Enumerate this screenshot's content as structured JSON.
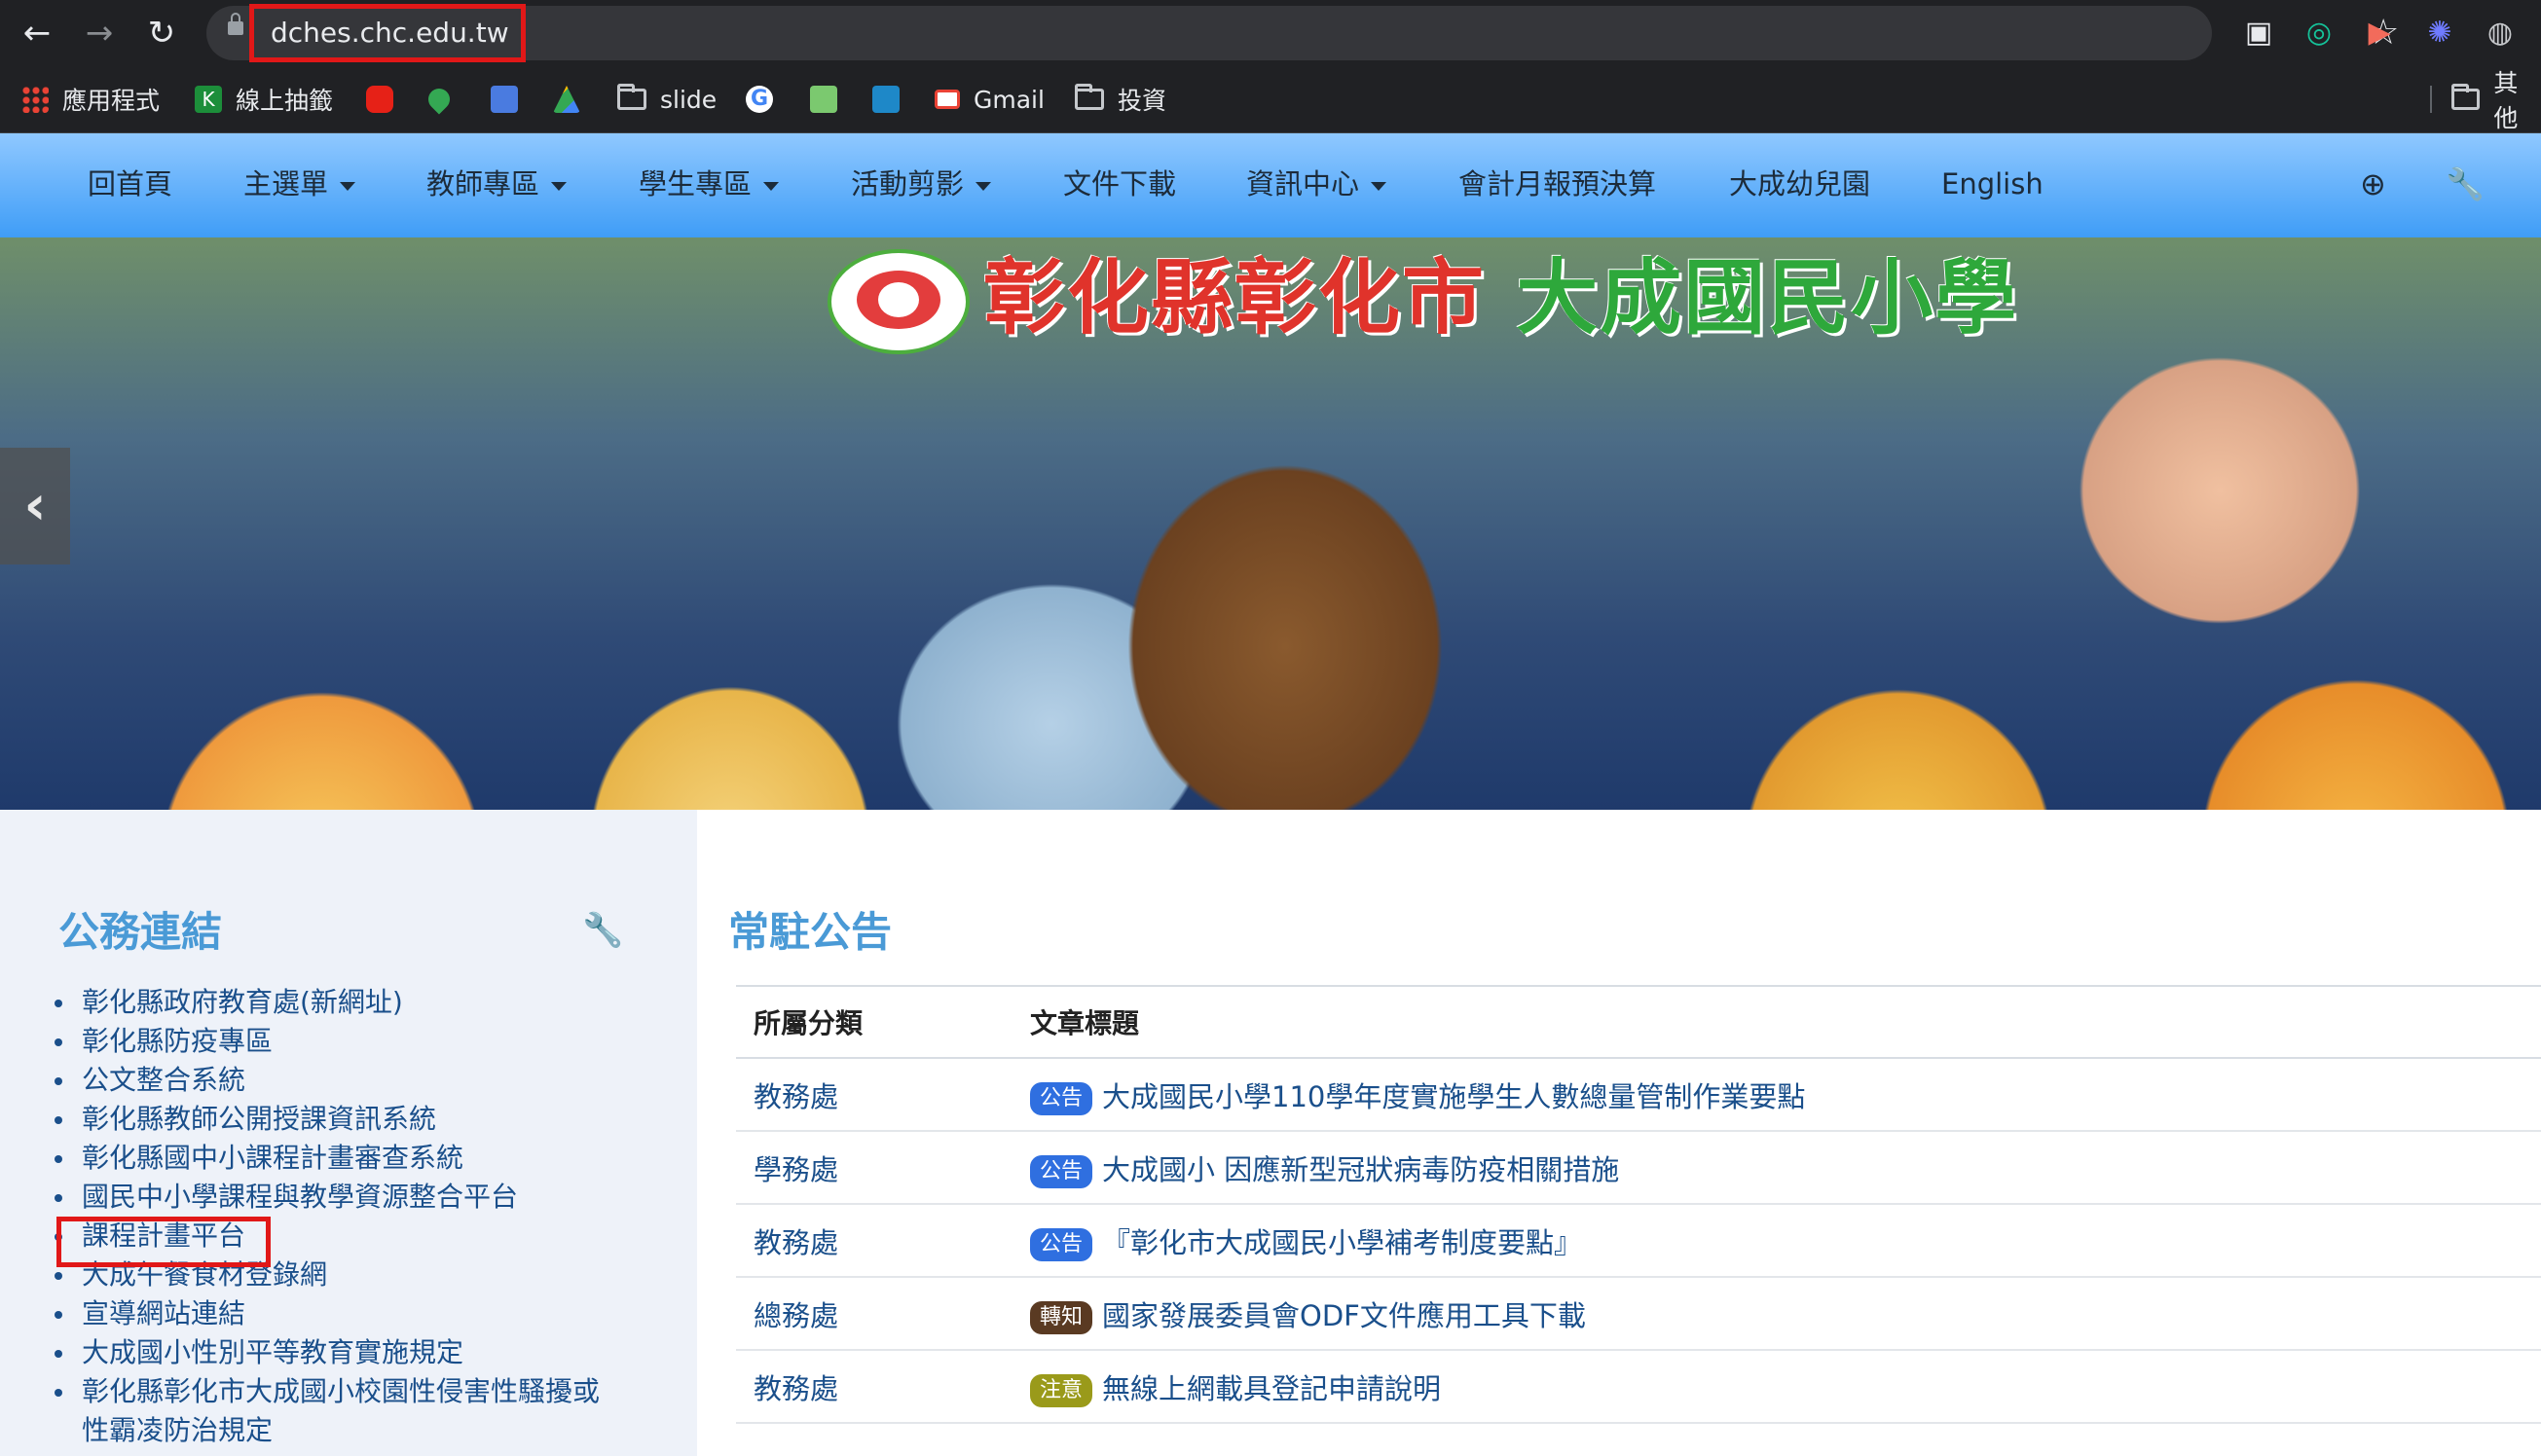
{
  "browser": {
    "url": "dches.chc.edu.tw",
    "bookmarks": [
      {
        "label": "應用程式",
        "icon": "apps-grid-icon"
      },
      {
        "label": "線上抽籤",
        "icon": "kahoot-k-icon"
      },
      {
        "label": "",
        "icon": "youtube-icon"
      },
      {
        "label": "",
        "icon": "maps-pin-icon"
      },
      {
        "label": "",
        "icon": "google-forms-icon"
      },
      {
        "label": "",
        "icon": "google-drive-icon"
      },
      {
        "label": "slide",
        "icon": "folder-icon"
      },
      {
        "label": "",
        "icon": "google-g-icon"
      },
      {
        "label": "",
        "icon": "sheet-icon"
      },
      {
        "label": "",
        "icon": "calendar-icon"
      },
      {
        "label": "Gmail",
        "icon": "gmail-icon"
      },
      {
        "label": "投資",
        "icon": "folder-icon"
      },
      {
        "label": "其他",
        "icon": "folder-icon"
      }
    ]
  },
  "nav": {
    "items": [
      {
        "label": "回首頁"
      },
      {
        "label": "主選單"
      },
      {
        "label": "教師專區"
      },
      {
        "label": "學生專區"
      },
      {
        "label": "活動剪影"
      },
      {
        "label": "文件下載"
      },
      {
        "label": "資訊中心"
      },
      {
        "label": "會計月報預決算"
      },
      {
        "label": "大成幼兒園"
      },
      {
        "label": "English"
      }
    ]
  },
  "banner": {
    "title_part1": "彰化縣彰化市",
    "title_part2": "大成國民小學"
  },
  "sidebar": {
    "title": "公務連結",
    "links": [
      "彰化縣政府教育處(新網址)",
      "彰化縣防疫專區",
      "公文整合系統",
      "彰化縣教師公開授課資訊系統",
      "彰化縣國中小課程計畫審查系統",
      "國民中小學課程與教學資源整合平台",
      "課程計畫平台",
      "大成午餐食材登錄網",
      "宣導網站連結",
      "大成國小性別平等教育實施規定",
      "彰化縣彰化市大成國小校園性侵害性騷擾或性霸凌防治規定"
    ]
  },
  "main": {
    "title": "常駐公告",
    "headers": {
      "category": "所屬分類",
      "title": "文章標題"
    },
    "rows": [
      {
        "category": "教務處",
        "badge": "公告",
        "badge_color": "#2f6fe0",
        "title": "大成國民小學110學年度實施學生人數總量管制作業要點"
      },
      {
        "category": "學務處",
        "badge": "公告",
        "badge_color": "#2f6fe0",
        "title": "大成國小 因應新型冠狀病毒防疫相關措施"
      },
      {
        "category": "教務處",
        "badge": "公告",
        "badge_color": "#2f6fe0",
        "title": "『彰化市大成國民小學補考制度要點』"
      },
      {
        "category": "總務處",
        "badge": "轉知",
        "badge_color": "#5a3a22",
        "title": "國家發展委員會ODF文件應用工具下載"
      },
      {
        "category": "教務處",
        "badge": "注意",
        "badge_color": "#9a9a1a",
        "title": "無線上網載具登記申請說明"
      }
    ]
  }
}
